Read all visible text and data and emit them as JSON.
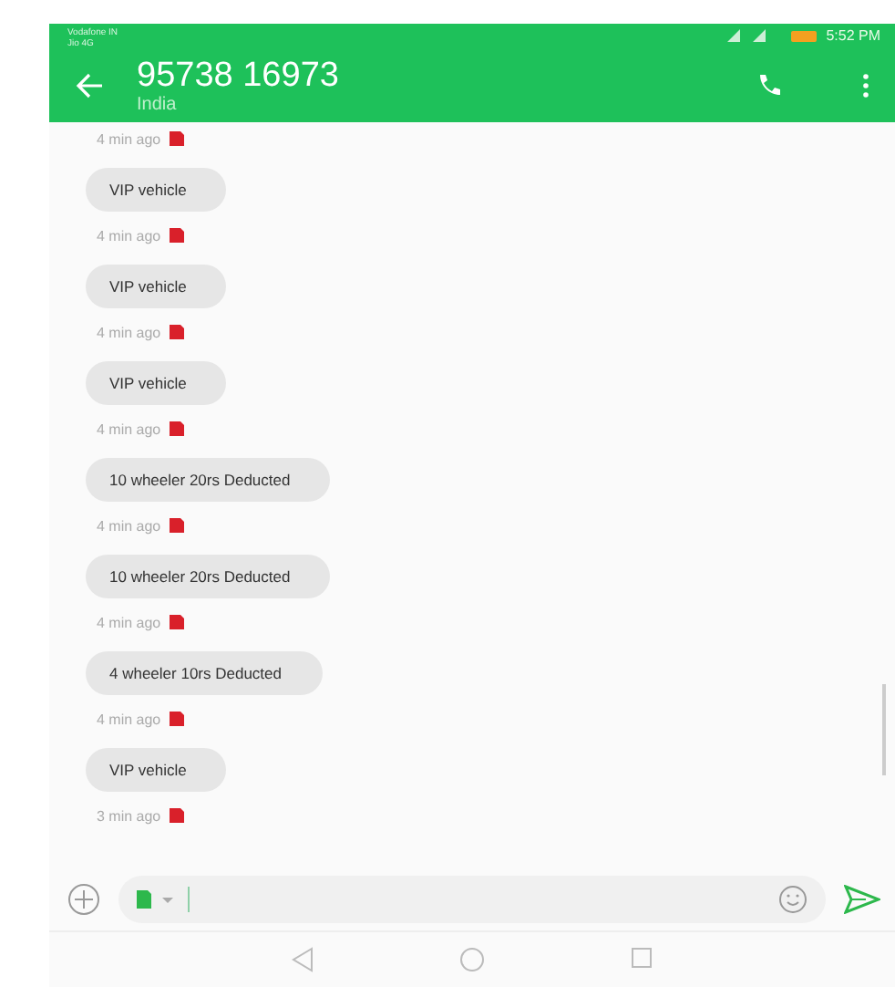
{
  "status_bar": {
    "carrier_1": "Vodafone IN",
    "carrier_2": "Jio 4G",
    "time": "5:52 PM"
  },
  "header": {
    "title": "95738 16973",
    "subtitle": "India"
  },
  "top_timestamp": "4 min ago",
  "messages": [
    {
      "text": "VIP vehicle",
      "time": "4 min ago"
    },
    {
      "text": "VIP vehicle",
      "time": "4 min ago"
    },
    {
      "text": "VIP vehicle",
      "time": "4 min ago"
    },
    {
      "text": "10 wheeler 20rs Deducted",
      "time": "4 min ago"
    },
    {
      "text": "10 wheeler 20rs Deducted",
      "time": "4 min ago"
    },
    {
      "text": "4 wheeler 10rs Deducted",
      "time": "4 min ago"
    },
    {
      "text": "VIP vehicle",
      "time": "3 min ago"
    }
  ]
}
